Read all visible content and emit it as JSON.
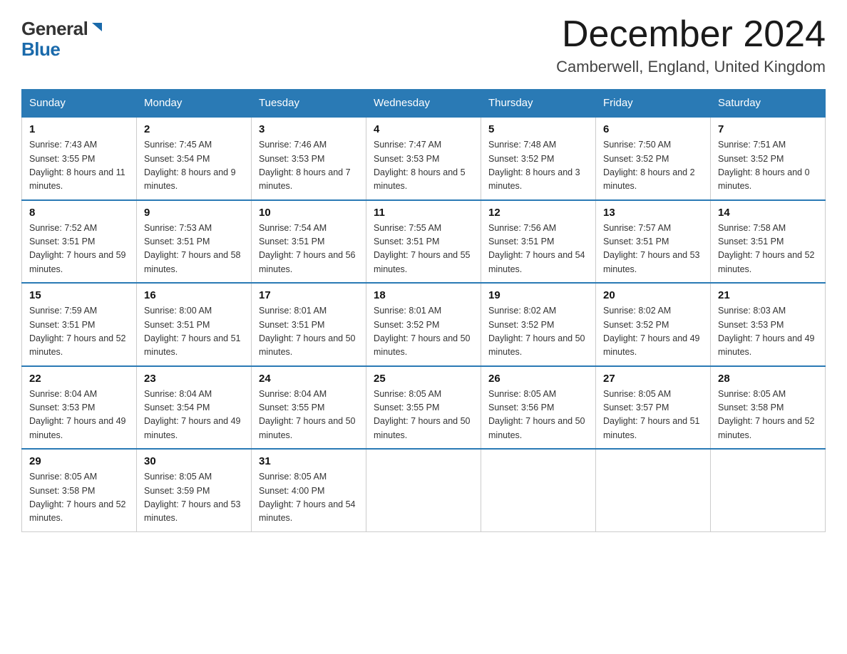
{
  "header": {
    "logo_line1": "General",
    "logo_line2": "Blue",
    "month_title": "December 2024",
    "location": "Camberwell, England, United Kingdom"
  },
  "weekdays": [
    "Sunday",
    "Monday",
    "Tuesday",
    "Wednesday",
    "Thursday",
    "Friday",
    "Saturday"
  ],
  "weeks": [
    [
      {
        "day": "1",
        "sunrise": "7:43 AM",
        "sunset": "3:55 PM",
        "daylight": "8 hours and 11 minutes."
      },
      {
        "day": "2",
        "sunrise": "7:45 AM",
        "sunset": "3:54 PM",
        "daylight": "8 hours and 9 minutes."
      },
      {
        "day": "3",
        "sunrise": "7:46 AM",
        "sunset": "3:53 PM",
        "daylight": "8 hours and 7 minutes."
      },
      {
        "day": "4",
        "sunrise": "7:47 AM",
        "sunset": "3:53 PM",
        "daylight": "8 hours and 5 minutes."
      },
      {
        "day": "5",
        "sunrise": "7:48 AM",
        "sunset": "3:52 PM",
        "daylight": "8 hours and 3 minutes."
      },
      {
        "day": "6",
        "sunrise": "7:50 AM",
        "sunset": "3:52 PM",
        "daylight": "8 hours and 2 minutes."
      },
      {
        "day": "7",
        "sunrise": "7:51 AM",
        "sunset": "3:52 PM",
        "daylight": "8 hours and 0 minutes."
      }
    ],
    [
      {
        "day": "8",
        "sunrise": "7:52 AM",
        "sunset": "3:51 PM",
        "daylight": "7 hours and 59 minutes."
      },
      {
        "day": "9",
        "sunrise": "7:53 AM",
        "sunset": "3:51 PM",
        "daylight": "7 hours and 58 minutes."
      },
      {
        "day": "10",
        "sunrise": "7:54 AM",
        "sunset": "3:51 PM",
        "daylight": "7 hours and 56 minutes."
      },
      {
        "day": "11",
        "sunrise": "7:55 AM",
        "sunset": "3:51 PM",
        "daylight": "7 hours and 55 minutes."
      },
      {
        "day": "12",
        "sunrise": "7:56 AM",
        "sunset": "3:51 PM",
        "daylight": "7 hours and 54 minutes."
      },
      {
        "day": "13",
        "sunrise": "7:57 AM",
        "sunset": "3:51 PM",
        "daylight": "7 hours and 53 minutes."
      },
      {
        "day": "14",
        "sunrise": "7:58 AM",
        "sunset": "3:51 PM",
        "daylight": "7 hours and 52 minutes."
      }
    ],
    [
      {
        "day": "15",
        "sunrise": "7:59 AM",
        "sunset": "3:51 PM",
        "daylight": "7 hours and 52 minutes."
      },
      {
        "day": "16",
        "sunrise": "8:00 AM",
        "sunset": "3:51 PM",
        "daylight": "7 hours and 51 minutes."
      },
      {
        "day": "17",
        "sunrise": "8:01 AM",
        "sunset": "3:51 PM",
        "daylight": "7 hours and 50 minutes."
      },
      {
        "day": "18",
        "sunrise": "8:01 AM",
        "sunset": "3:52 PM",
        "daylight": "7 hours and 50 minutes."
      },
      {
        "day": "19",
        "sunrise": "8:02 AM",
        "sunset": "3:52 PM",
        "daylight": "7 hours and 50 minutes."
      },
      {
        "day": "20",
        "sunrise": "8:02 AM",
        "sunset": "3:52 PM",
        "daylight": "7 hours and 49 minutes."
      },
      {
        "day": "21",
        "sunrise": "8:03 AM",
        "sunset": "3:53 PM",
        "daylight": "7 hours and 49 minutes."
      }
    ],
    [
      {
        "day": "22",
        "sunrise": "8:04 AM",
        "sunset": "3:53 PM",
        "daylight": "7 hours and 49 minutes."
      },
      {
        "day": "23",
        "sunrise": "8:04 AM",
        "sunset": "3:54 PM",
        "daylight": "7 hours and 49 minutes."
      },
      {
        "day": "24",
        "sunrise": "8:04 AM",
        "sunset": "3:55 PM",
        "daylight": "7 hours and 50 minutes."
      },
      {
        "day": "25",
        "sunrise": "8:05 AM",
        "sunset": "3:55 PM",
        "daylight": "7 hours and 50 minutes."
      },
      {
        "day": "26",
        "sunrise": "8:05 AM",
        "sunset": "3:56 PM",
        "daylight": "7 hours and 50 minutes."
      },
      {
        "day": "27",
        "sunrise": "8:05 AM",
        "sunset": "3:57 PM",
        "daylight": "7 hours and 51 minutes."
      },
      {
        "day": "28",
        "sunrise": "8:05 AM",
        "sunset": "3:58 PM",
        "daylight": "7 hours and 52 minutes."
      }
    ],
    [
      {
        "day": "29",
        "sunrise": "8:05 AM",
        "sunset": "3:58 PM",
        "daylight": "7 hours and 52 minutes."
      },
      {
        "day": "30",
        "sunrise": "8:05 AM",
        "sunset": "3:59 PM",
        "daylight": "7 hours and 53 minutes."
      },
      {
        "day": "31",
        "sunrise": "8:05 AM",
        "sunset": "4:00 PM",
        "daylight": "7 hours and 54 minutes."
      },
      null,
      null,
      null,
      null
    ]
  ]
}
